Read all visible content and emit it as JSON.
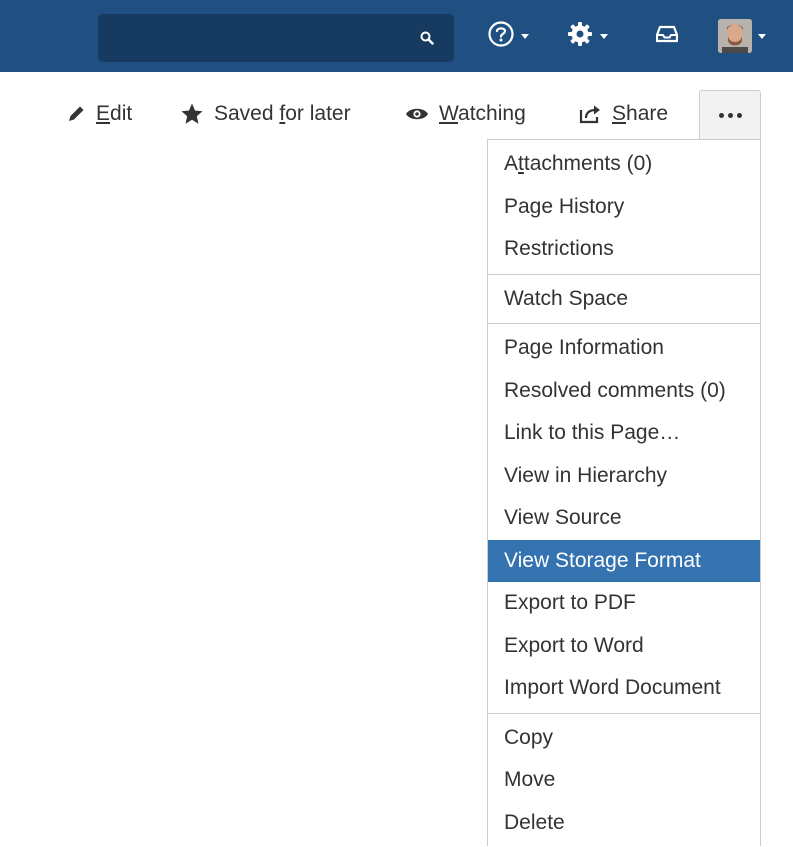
{
  "header": {
    "search_placeholder": "",
    "help_icon": "help-icon",
    "settings_icon": "gear-icon",
    "notifications_icon": "inbox-icon",
    "brand_color": "#205081"
  },
  "actions": {
    "edit_rest": "dit",
    "edit_first": "E",
    "saved_pre": "Saved ",
    "saved_ul": "f",
    "saved_post": "or later",
    "watching_ul": "W",
    "watching_rest": "atching",
    "share_ul": "S",
    "share_rest": "hare"
  },
  "menu": {
    "groups": [
      {
        "items": [
          {
            "pre": "A",
            "ul": "t",
            "post": "tachments (0)"
          },
          {
            "label": "Page History"
          },
          {
            "label": "Restrictions"
          }
        ]
      },
      {
        "items": [
          {
            "label": "Watch Space"
          }
        ]
      },
      {
        "items": [
          {
            "label": "Page Information"
          },
          {
            "label": "Resolved comments (0)"
          },
          {
            "label": "Link to this Page…"
          },
          {
            "label": "View in Hierarchy"
          },
          {
            "label": "View Source"
          },
          {
            "label": "View Storage Format",
            "active": true
          },
          {
            "label": "Export to PDF"
          },
          {
            "label": "Export to Word"
          },
          {
            "label": "Import Word Document"
          }
        ]
      },
      {
        "items": [
          {
            "label": "Copy"
          },
          {
            "label": "Move"
          },
          {
            "label": "Delete"
          }
        ]
      }
    ],
    "highlight_color": "#3572b0"
  }
}
